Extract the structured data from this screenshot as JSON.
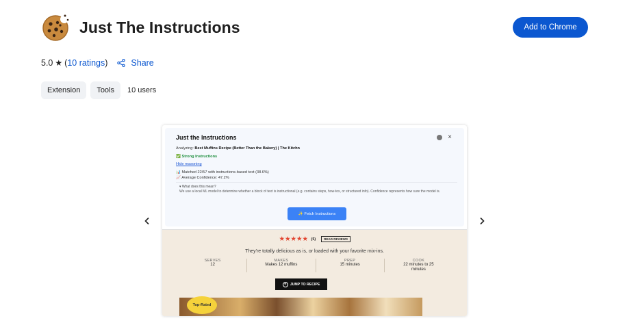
{
  "header": {
    "title": "Just The Instructions",
    "add_button": "Add to Chrome",
    "icon": "cookie-icon"
  },
  "rating": {
    "score": "5.0",
    "star": "★",
    "ratings_open": "(",
    "ratings_link": "10 ratings",
    "ratings_close": ")",
    "share": "Share"
  },
  "chips": {
    "items": [
      "Extension",
      "Tools"
    ],
    "users": "10 users"
  },
  "carousel": {
    "prev_icon": "chevron-left-icon",
    "next_icon": "chevron-right-icon"
  },
  "screenshot": {
    "popup": {
      "title": "Just the Instructions",
      "close": "×",
      "analyzing_label": "Analyzing: ",
      "analyzing_value": "Best Muffins Recipe (Better Than the Bakery) | The Kitchn",
      "status": "✅ Strong Instructions",
      "hide_reasoning": "Hide reasoning",
      "matched": "📊 Matched 22/57 with instructions-based text (38.6%)",
      "confidence": "📈 Average Confidence: 47.2%",
      "what_title": "▾ What does this mean?",
      "what_body": "We use a local ML model to determine whether a block of text is instructional (e.g. contains steps, how-tos, or structured info). Confidence represents how sure the model is.",
      "fetch": "✨ Fetch Instructions"
    },
    "page": {
      "stars": "★★★★★",
      "review_count": "(5)",
      "read_reviews": "READ REVIEWS",
      "description": "They're totally delicious as is, or loaded with your favorite mix-ins.",
      "meta": [
        {
          "label": "SERVES",
          "value": "12"
        },
        {
          "label": "MAKES",
          "value": "Makes 12 muffins"
        },
        {
          "label": "PREP",
          "value": "15 minutes"
        },
        {
          "label": "COOK",
          "value": "22 minutes to 25 minutes"
        }
      ],
      "jump": "JUMP TO RECIPE",
      "badge": "Top-Rated"
    }
  }
}
